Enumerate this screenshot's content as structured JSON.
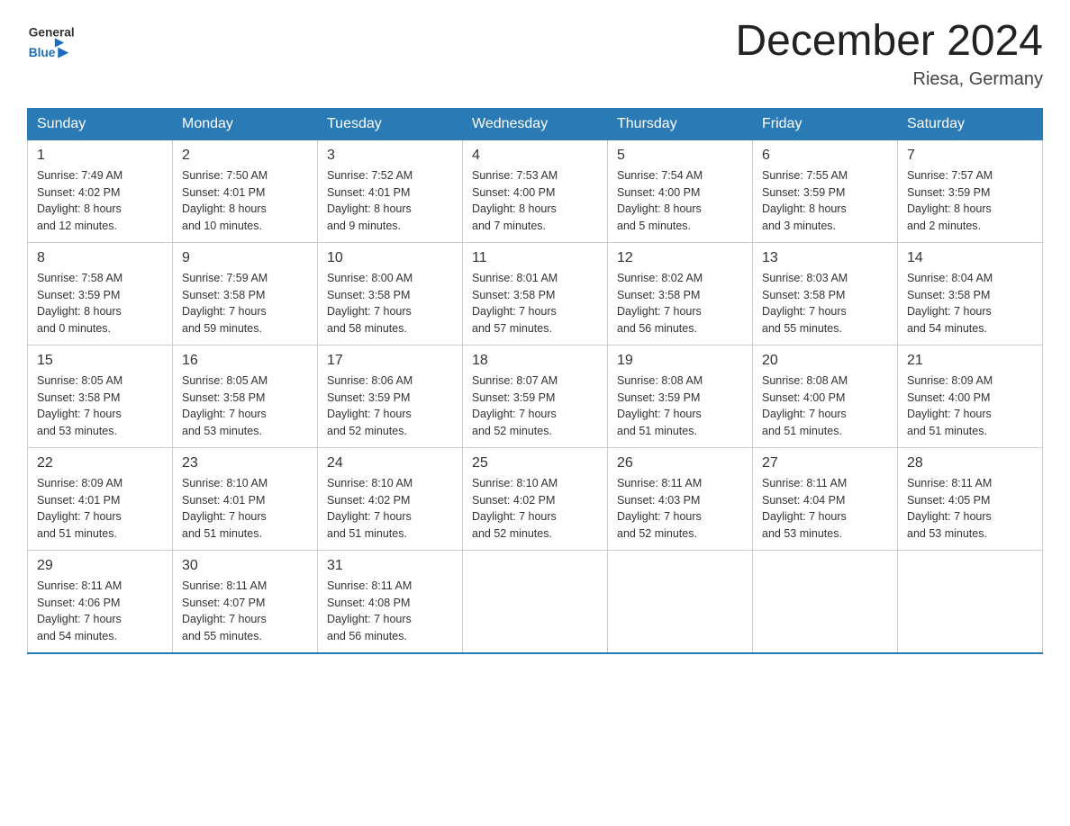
{
  "logo": {
    "general": "General",
    "blue": "Blue"
  },
  "title": "December 2024",
  "subtitle": "Riesa, Germany",
  "weekdays": [
    "Sunday",
    "Monday",
    "Tuesday",
    "Wednesday",
    "Thursday",
    "Friday",
    "Saturday"
  ],
  "weeks": [
    [
      {
        "day": "1",
        "info": "Sunrise: 7:49 AM\nSunset: 4:02 PM\nDaylight: 8 hours\nand 12 minutes."
      },
      {
        "day": "2",
        "info": "Sunrise: 7:50 AM\nSunset: 4:01 PM\nDaylight: 8 hours\nand 10 minutes."
      },
      {
        "day": "3",
        "info": "Sunrise: 7:52 AM\nSunset: 4:01 PM\nDaylight: 8 hours\nand 9 minutes."
      },
      {
        "day": "4",
        "info": "Sunrise: 7:53 AM\nSunset: 4:00 PM\nDaylight: 8 hours\nand 7 minutes."
      },
      {
        "day": "5",
        "info": "Sunrise: 7:54 AM\nSunset: 4:00 PM\nDaylight: 8 hours\nand 5 minutes."
      },
      {
        "day": "6",
        "info": "Sunrise: 7:55 AM\nSunset: 3:59 PM\nDaylight: 8 hours\nand 3 minutes."
      },
      {
        "day": "7",
        "info": "Sunrise: 7:57 AM\nSunset: 3:59 PM\nDaylight: 8 hours\nand 2 minutes."
      }
    ],
    [
      {
        "day": "8",
        "info": "Sunrise: 7:58 AM\nSunset: 3:59 PM\nDaylight: 8 hours\nand 0 minutes."
      },
      {
        "day": "9",
        "info": "Sunrise: 7:59 AM\nSunset: 3:58 PM\nDaylight: 7 hours\nand 59 minutes."
      },
      {
        "day": "10",
        "info": "Sunrise: 8:00 AM\nSunset: 3:58 PM\nDaylight: 7 hours\nand 58 minutes."
      },
      {
        "day": "11",
        "info": "Sunrise: 8:01 AM\nSunset: 3:58 PM\nDaylight: 7 hours\nand 57 minutes."
      },
      {
        "day": "12",
        "info": "Sunrise: 8:02 AM\nSunset: 3:58 PM\nDaylight: 7 hours\nand 56 minutes."
      },
      {
        "day": "13",
        "info": "Sunrise: 8:03 AM\nSunset: 3:58 PM\nDaylight: 7 hours\nand 55 minutes."
      },
      {
        "day": "14",
        "info": "Sunrise: 8:04 AM\nSunset: 3:58 PM\nDaylight: 7 hours\nand 54 minutes."
      }
    ],
    [
      {
        "day": "15",
        "info": "Sunrise: 8:05 AM\nSunset: 3:58 PM\nDaylight: 7 hours\nand 53 minutes."
      },
      {
        "day": "16",
        "info": "Sunrise: 8:05 AM\nSunset: 3:58 PM\nDaylight: 7 hours\nand 53 minutes."
      },
      {
        "day": "17",
        "info": "Sunrise: 8:06 AM\nSunset: 3:59 PM\nDaylight: 7 hours\nand 52 minutes."
      },
      {
        "day": "18",
        "info": "Sunrise: 8:07 AM\nSunset: 3:59 PM\nDaylight: 7 hours\nand 52 minutes."
      },
      {
        "day": "19",
        "info": "Sunrise: 8:08 AM\nSunset: 3:59 PM\nDaylight: 7 hours\nand 51 minutes."
      },
      {
        "day": "20",
        "info": "Sunrise: 8:08 AM\nSunset: 4:00 PM\nDaylight: 7 hours\nand 51 minutes."
      },
      {
        "day": "21",
        "info": "Sunrise: 8:09 AM\nSunset: 4:00 PM\nDaylight: 7 hours\nand 51 minutes."
      }
    ],
    [
      {
        "day": "22",
        "info": "Sunrise: 8:09 AM\nSunset: 4:01 PM\nDaylight: 7 hours\nand 51 minutes."
      },
      {
        "day": "23",
        "info": "Sunrise: 8:10 AM\nSunset: 4:01 PM\nDaylight: 7 hours\nand 51 minutes."
      },
      {
        "day": "24",
        "info": "Sunrise: 8:10 AM\nSunset: 4:02 PM\nDaylight: 7 hours\nand 51 minutes."
      },
      {
        "day": "25",
        "info": "Sunrise: 8:10 AM\nSunset: 4:02 PM\nDaylight: 7 hours\nand 52 minutes."
      },
      {
        "day": "26",
        "info": "Sunrise: 8:11 AM\nSunset: 4:03 PM\nDaylight: 7 hours\nand 52 minutes."
      },
      {
        "day": "27",
        "info": "Sunrise: 8:11 AM\nSunset: 4:04 PM\nDaylight: 7 hours\nand 53 minutes."
      },
      {
        "day": "28",
        "info": "Sunrise: 8:11 AM\nSunset: 4:05 PM\nDaylight: 7 hours\nand 53 minutes."
      }
    ],
    [
      {
        "day": "29",
        "info": "Sunrise: 8:11 AM\nSunset: 4:06 PM\nDaylight: 7 hours\nand 54 minutes."
      },
      {
        "day": "30",
        "info": "Sunrise: 8:11 AM\nSunset: 4:07 PM\nDaylight: 7 hours\nand 55 minutes."
      },
      {
        "day": "31",
        "info": "Sunrise: 8:11 AM\nSunset: 4:08 PM\nDaylight: 7 hours\nand 56 minutes."
      },
      {
        "day": "",
        "info": ""
      },
      {
        "day": "",
        "info": ""
      },
      {
        "day": "",
        "info": ""
      },
      {
        "day": "",
        "info": ""
      }
    ]
  ]
}
